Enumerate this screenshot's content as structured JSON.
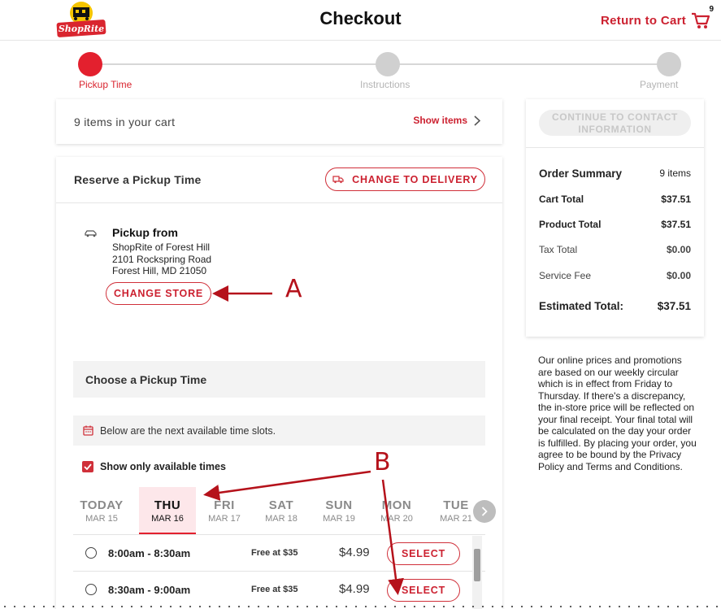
{
  "header": {
    "logo_text": "ShopRite",
    "title": "Checkout",
    "return_cart": "Return to Cart",
    "cart_count": "9"
  },
  "steps": [
    {
      "label": "Pickup Time",
      "active": true
    },
    {
      "label": "Instructions",
      "active": false
    },
    {
      "label": "Payment",
      "active": false
    }
  ],
  "cart": {
    "count_text": "9 items in your cart",
    "show_items": "Show items"
  },
  "reserve": {
    "title": "Reserve a Pickup Time",
    "change_delivery": "CHANGE TO DELIVERY",
    "pickup_from": "Pickup from",
    "store_name": "ShopRite of Forest Hill",
    "store_address1": "2101 Rockspring Road",
    "store_address2": "Forest Hill, MD 21050",
    "change_store": "CHANGE STORE",
    "choose_title": "Choose a Pickup Time",
    "info_text": "Below are the next available time slots.",
    "show_available": "Show only available times"
  },
  "days": [
    {
      "name": "TODAY",
      "date": "MAR 15",
      "selected": false
    },
    {
      "name": "THU",
      "date": "MAR 16",
      "selected": true
    },
    {
      "name": "FRI",
      "date": "MAR 17",
      "selected": false
    },
    {
      "name": "SAT",
      "date": "MAR 18",
      "selected": false
    },
    {
      "name": "SUN",
      "date": "MAR 19",
      "selected": false
    },
    {
      "name": "MON",
      "date": "MAR 20",
      "selected": false
    },
    {
      "name": "TUE",
      "date": "MAR 21",
      "selected": false
    }
  ],
  "slots": [
    {
      "time": "8:00am - 8:30am",
      "free": "Free at $35",
      "price": "$4.99",
      "action": "SELECT"
    },
    {
      "time": "8:30am - 9:00am",
      "free": "Free at $35",
      "price": "$4.99",
      "action": "SELECT"
    }
  ],
  "summary": {
    "continue_btn": "CONTINUE TO CONTACT INFORMATION",
    "title": "Order Summary",
    "items": "9 items",
    "cart_total_label": "Cart Total",
    "cart_total": "$37.51",
    "product_total_label": "Product Total",
    "product_total": "$37.51",
    "tax_label": "Tax Total",
    "tax": "$0.00",
    "fee_label": "Service Fee",
    "fee": "$0.00",
    "estimated_label": "Estimated Total:",
    "estimated": "$37.51"
  },
  "disclaimer": "Our online prices and promotions are based on our weekly circular which is in effect from Friday to Thursday. If there's a discrepancy, the in-store price will be reflected on your final receipt. Your final total will be calculated on the day your order is fulfilled. By placing your order, you agree to be bound by the Privacy Policy and Terms and Conditions.",
  "annotations": {
    "a": "A",
    "b": "B"
  },
  "colors": {
    "brand_red": "#e3202e",
    "text_red": "#cc2130",
    "annotation": "#b5121b"
  }
}
